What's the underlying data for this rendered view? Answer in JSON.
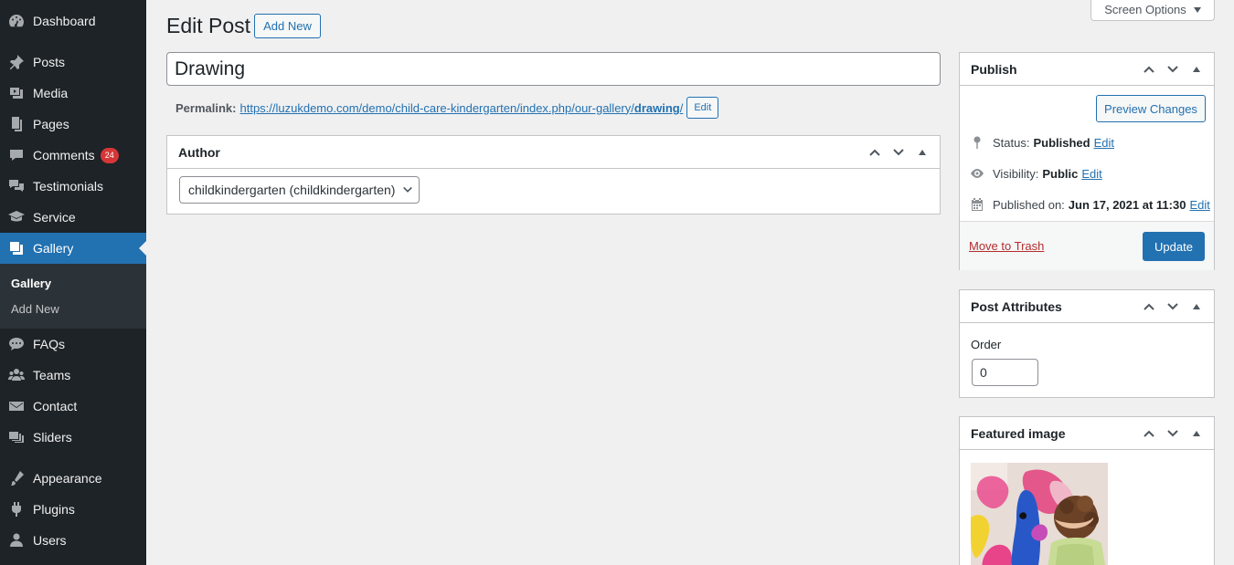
{
  "sidebar": {
    "items": [
      {
        "label": "Dashboard",
        "icon": "dashboard-icon"
      },
      {
        "label": "Posts",
        "icon": "pin-icon"
      },
      {
        "label": "Media",
        "icon": "media-icon"
      },
      {
        "label": "Pages",
        "icon": "pages-icon"
      },
      {
        "label": "Comments",
        "icon": "comments-icon",
        "badge": "24"
      },
      {
        "label": "Testimonials",
        "icon": "testimonials-icon"
      },
      {
        "label": "Service",
        "icon": "service-icon"
      },
      {
        "label": "Gallery",
        "icon": "gallery-icon",
        "current": true
      },
      {
        "label": "FAQs",
        "icon": "faq-icon"
      },
      {
        "label": "Teams",
        "icon": "teams-icon"
      },
      {
        "label": "Contact",
        "icon": "contact-icon"
      },
      {
        "label": "Sliders",
        "icon": "sliders-icon"
      },
      {
        "label": "Appearance",
        "icon": "appearance-icon"
      },
      {
        "label": "Plugins",
        "icon": "plugins-icon"
      },
      {
        "label": "Users",
        "icon": "users-icon"
      }
    ],
    "submenu": [
      "Gallery",
      "Add New"
    ]
  },
  "header": {
    "title": "Edit Post",
    "add_new": "Add New",
    "screen_options": "Screen Options"
  },
  "post": {
    "title": "Drawing",
    "permalink_label": "Permalink:",
    "permalink_base": "https://luzukdemo.com/demo/child-care-kindergarten/index.php/our-gallery/",
    "permalink_slug": "drawing",
    "permalink_trailing": "/",
    "permalink_edit": "Edit"
  },
  "author_box": {
    "title": "Author",
    "selected": "childkindergarten (childkindergarten)"
  },
  "publish_box": {
    "title": "Publish",
    "preview": "Preview Changes",
    "status_label": "Status:",
    "status_value": "Published",
    "visibility_label": "Visibility:",
    "visibility_value": "Public",
    "published_label": "Published on:",
    "published_value": "Jun 17, 2021 at 11:30",
    "edit": "Edit",
    "trash": "Move to Trash",
    "update": "Update"
  },
  "attributes_box": {
    "title": "Post Attributes",
    "order_label": "Order",
    "order_value": "0"
  },
  "featured_box": {
    "title": "Featured image"
  },
  "colors": {
    "accent": "#2271b1",
    "sidebar_bg": "#1d2327",
    "badge": "#d63638",
    "trash": "#b32d2e"
  }
}
